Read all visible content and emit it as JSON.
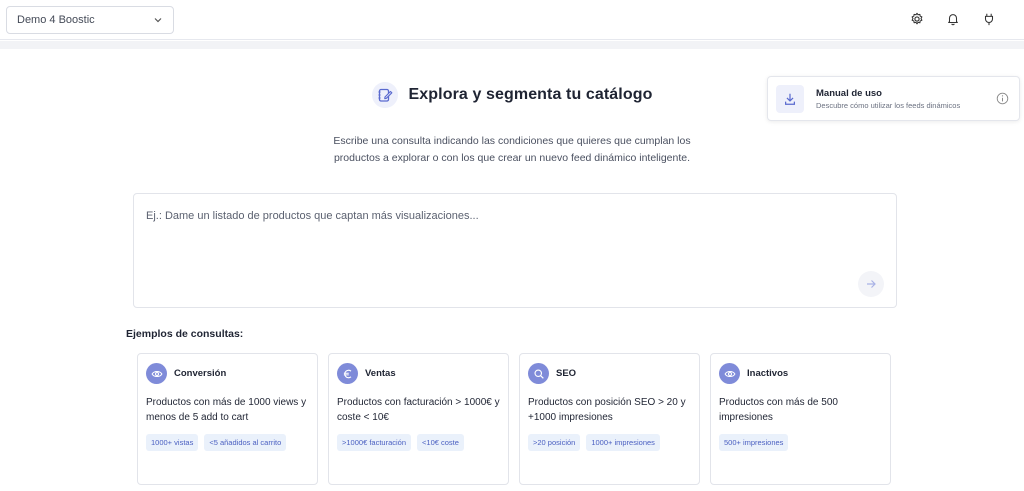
{
  "header": {
    "store_selector": "Demo 4 Boostic",
    "icons": [
      "settings-icon",
      "bell-icon",
      "plug-icon"
    ]
  },
  "manual": {
    "title": "Manual de uso",
    "subtitle": "Descubre cómo utilizar los feeds dinámicos"
  },
  "hero": {
    "title": "Explora y segmenta tu catálogo",
    "description_line1": "Escribe una consulta indicando las condiciones que quieres que cumplan los",
    "description_line2": "productos a explorar o con los que crear un nuevo feed dinámico inteligente."
  },
  "query": {
    "placeholder": "Ej.: Dame un listado de productos que captan más visualizaciones...",
    "value": ""
  },
  "examples": {
    "title": "Ejemplos de consultas:",
    "cards": [
      {
        "icon": "eye-icon",
        "title": "Conversión",
        "text": "Productos con más de 1000 views y menos de 5 add to cart",
        "tags": [
          "1000+ vistas",
          "<5 añadidos al carrito"
        ]
      },
      {
        "icon": "euro-icon",
        "title": "Ventas",
        "text": "Productos con facturación > 1000€ y coste < 10€",
        "tags": [
          ">1000€ facturación",
          "<10€ coste"
        ]
      },
      {
        "icon": "search-icon",
        "title": "SEO",
        "text": "Productos con posición SEO > 20 y +1000 impresiones",
        "tags": [
          ">20 posición",
          "1000+ impresiones"
        ]
      },
      {
        "icon": "eye-icon",
        "title": "Inactivos",
        "text": "Productos con más de 500 impresiones",
        "tags": [
          "500+ impresiones"
        ]
      }
    ]
  },
  "colors": {
    "accent": "#7f8bd9",
    "tag_bg": "#eaf1fb",
    "tag_text": "#4a5fc1"
  }
}
